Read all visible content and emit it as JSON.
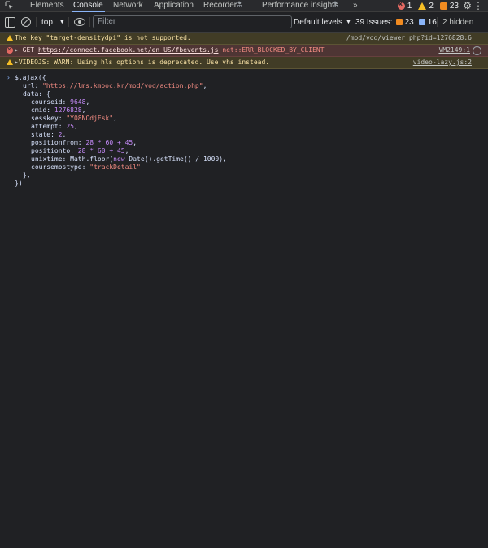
{
  "tabs": [
    "Elements",
    "Console",
    "Network",
    "Application",
    "Recorder",
    "Performance insights"
  ],
  "active_tab": "Console",
  "more_tabs": "»",
  "header_counts": {
    "errors": "1",
    "warnings": "2",
    "issues": "23"
  },
  "toolbar": {
    "context": "top",
    "filter_placeholder": "Filter",
    "levels": "Default levels",
    "issues_label": "39 Issues:",
    "issues_orange": "23",
    "issues_blue": "16",
    "hidden": "2 hidden"
  },
  "messages": [
    {
      "type": "warning",
      "text": "The key \"target-densitydpi\" is not supported.",
      "source": "/mod/vod/viewer.php?id=1276828:6"
    },
    {
      "type": "error",
      "method": "GET",
      "url": "https://connect.facebook.net/en_US/fbevents.js",
      "code": "net::ERR_BLOCKED_BY_CLIENT",
      "source": "VM2149:1"
    },
    {
      "type": "warning",
      "text": "VIDEOJS: WARN: Using hls options is deprecated. Use vhs instead.",
      "source": "video-lazy.js:2"
    }
  ],
  "code": {
    "l1": "$.ajax({",
    "url_key": "url: ",
    "url_val": "\"https://lms.kmooc.kr/mod/vod/action.php\"",
    "data_key": "data: {",
    "courseid_key": "courseid: ",
    "courseid_val": "9648",
    "cmid_key": "cmid: ",
    "cmid_val": "1276828",
    "sesskey_key": "sesskey: ",
    "sesskey_val": "\"Y08NOdjEsk\"",
    "attempt_key": "attempt: ",
    "attempt_val": "25",
    "state_key": "state: ",
    "state_val": "2",
    "posfrom_key": "positionfrom: ",
    "posfrom_val": "28 * 60 + 45",
    "posto_key": "positionto: ",
    "posto_val": "28 * 60 + 45",
    "unix_key": "unixtime: ",
    "unix_pre": "Math.floor(",
    "unix_new": "new",
    "unix_post": " Date().getTime() / 1000),",
    "cmt_key": "coursemostype: ",
    "cmt_val": "\"trackDetail\"",
    "close_data": "},",
    "close_all": "})"
  }
}
